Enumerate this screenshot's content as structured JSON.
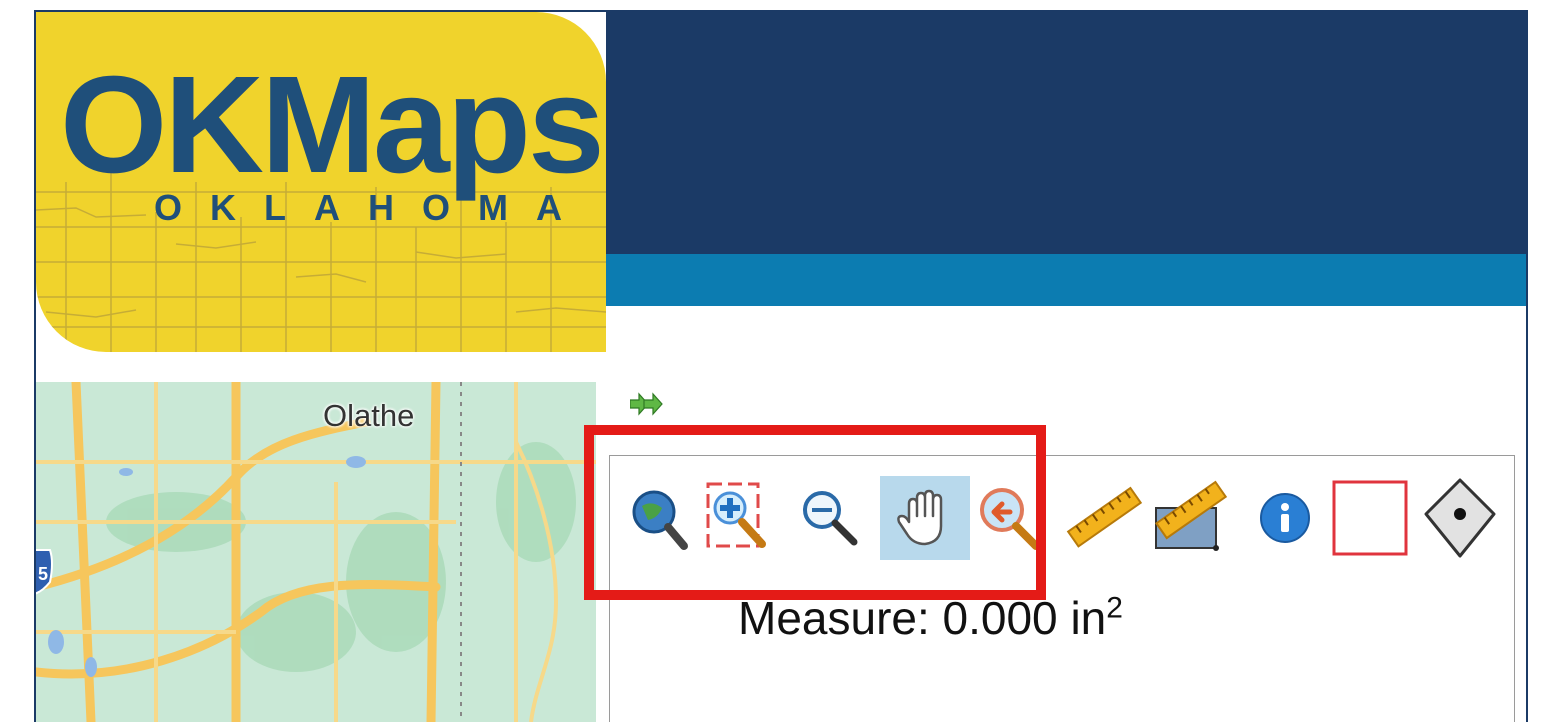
{
  "logo": {
    "title": "OKMaps",
    "subtitle": "OKLAHOMA"
  },
  "map": {
    "city_label": "Olathe",
    "highway_label": "5"
  },
  "toolbar": {
    "tools": [
      {
        "name": "zoom-full-extent",
        "icon": "globe-magnifier-icon"
      },
      {
        "name": "zoom-in",
        "icon": "zoom-in-box-icon"
      },
      {
        "name": "zoom-out",
        "icon": "zoom-out-icon"
      },
      {
        "name": "pan",
        "icon": "hand-icon",
        "active": true
      },
      {
        "name": "zoom-previous",
        "icon": "zoom-back-icon"
      },
      {
        "name": "measure-distance",
        "icon": "ruler-icon"
      },
      {
        "name": "measure-area",
        "icon": "ruler-area-icon"
      },
      {
        "name": "identify",
        "icon": "info-icon"
      },
      {
        "name": "select-rectangle",
        "icon": "rectangle-icon"
      },
      {
        "name": "add-point",
        "icon": "marker-icon"
      }
    ],
    "measure_label": "Measure:",
    "measure_value": "0.000",
    "measure_unit": "in",
    "measure_exponent": "2"
  },
  "colors": {
    "banner_dark": "#1b3a66",
    "banner_light": "#0c7cb1",
    "logo_bg": "#f0d32c",
    "highlight": "#e41b17",
    "active_tool_bg": "#b8d9ec"
  }
}
